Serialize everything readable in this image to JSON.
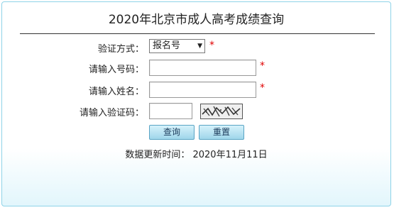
{
  "title": "2020年北京市成人高考成绩查询",
  "required_mark": "*",
  "form": {
    "verify_method": {
      "label": "验证方式：",
      "selected": "报名号"
    },
    "number": {
      "label": "请输入号码：",
      "value": ""
    },
    "name": {
      "label": "请输入姓名：",
      "value": ""
    },
    "captcha": {
      "label": "请输入验证码：",
      "value": "",
      "image_text": "2a3p8"
    }
  },
  "buttons": {
    "query": "查询",
    "reset": "重置"
  },
  "update_time": {
    "label": "数据更新时间：",
    "value": "2020年11月11日"
  }
}
